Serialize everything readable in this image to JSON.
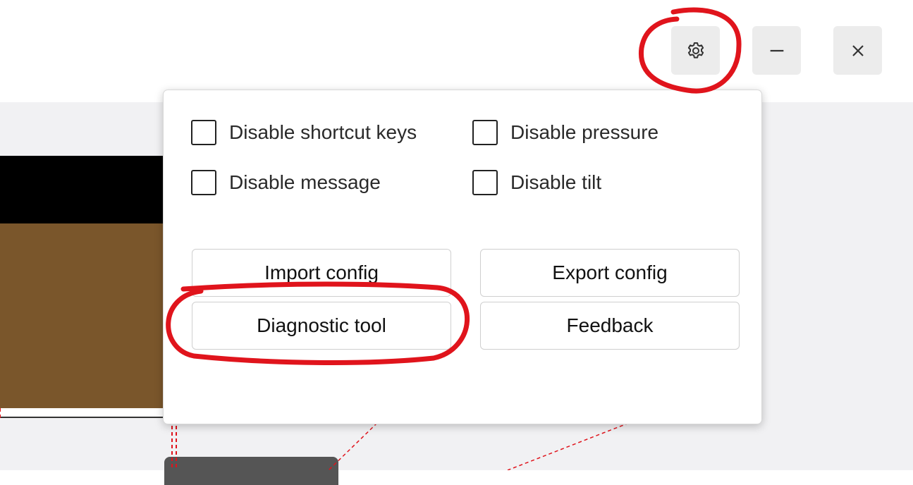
{
  "window_controls": {
    "settings": {
      "icon": "gear-icon"
    },
    "minimize": {
      "icon": "minus-icon"
    },
    "close": {
      "icon": "close-icon"
    }
  },
  "settings_menu": {
    "options": [
      {
        "label": "Disable shortcut keys",
        "checked": false
      },
      {
        "label": "Disable pressure",
        "checked": false
      },
      {
        "label": "Disable message",
        "checked": false
      },
      {
        "label": "Disable tilt",
        "checked": false
      }
    ],
    "buttons": {
      "import_config": "Import config",
      "export_config": "Export config",
      "diagnostic_tool": "Diagnostic tool",
      "feedback": "Feedback"
    }
  },
  "colors": {
    "annotation": "#e0141c",
    "preview_brown": "#7a562b",
    "content_background": "#f1f1f3"
  }
}
